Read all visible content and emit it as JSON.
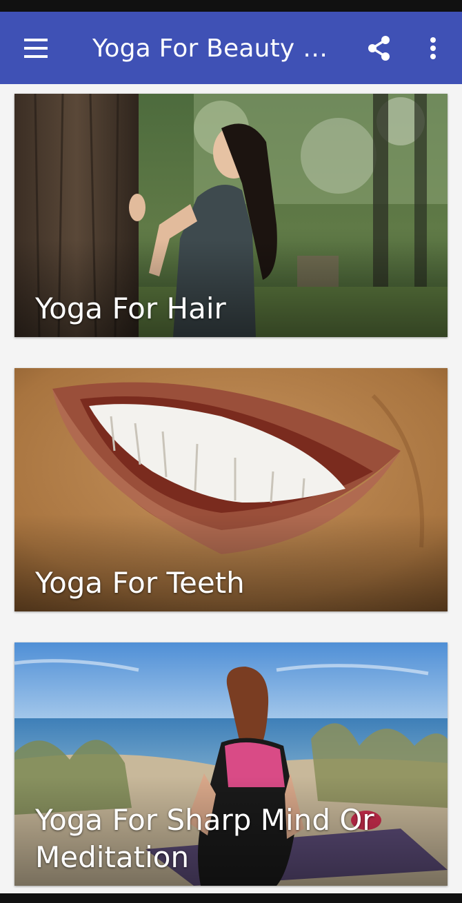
{
  "app_bar": {
    "title": "Yoga For Beauty An...",
    "menu_icon": "menu-icon",
    "share_icon": "share-icon",
    "more_icon": "more-vert-icon",
    "background_color": "#3f51b5"
  },
  "cards": [
    {
      "label": "Yoga For Hair",
      "image": "woman-with-long-hair-by-tree"
    },
    {
      "label": "Yoga For Teeth",
      "image": "smiling-mouth-with-white-teeth"
    },
    {
      "label": "Yoga For Sharp Mind Or Meditation",
      "image": "woman-meditating-on-beach"
    }
  ]
}
